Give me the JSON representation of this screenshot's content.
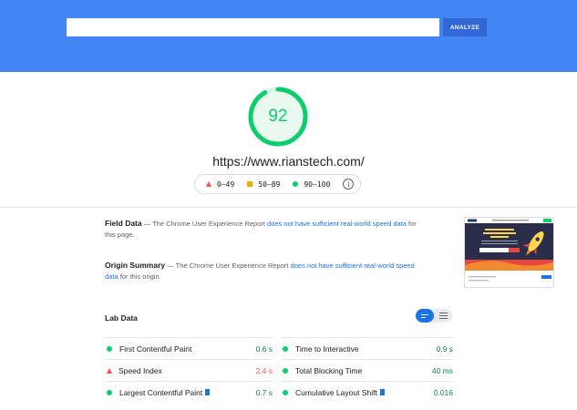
{
  "header": {
    "url_input_value": "",
    "analyze_label": "ANALYZE"
  },
  "score": {
    "value": "92",
    "fraction": 0.92,
    "color": "#0cce6b"
  },
  "site_url": "https://www.rianstech.com/",
  "legend": {
    "fail": "0–49",
    "average": "50–89",
    "pass": "90–100"
  },
  "field_data": {
    "heading": "Field Data",
    "text_before": " — The Chrome User Experience Report ",
    "link": "does not have sufficient real-world speed data",
    "text_after": " for this page."
  },
  "origin_summary": {
    "heading": "Origin Summary",
    "text_before": " — The Chrome User Experience Report ",
    "link": "does not have sufficient real-world speed data",
    "text_after": " for this origin."
  },
  "lab": {
    "title": "Lab Data"
  },
  "metrics": [
    {
      "name": "First Contentful Paint",
      "value": "0.6 s",
      "status": "pass",
      "flag": false
    },
    {
      "name": "Time to Interactive",
      "value": "0.9 s",
      "status": "pass",
      "flag": false
    },
    {
      "name": "Speed Index",
      "value": "2.4 s",
      "status": "fail",
      "flag": false
    },
    {
      "name": "Total Blocking Time",
      "value": "40 ms",
      "status": "pass",
      "flag": false
    },
    {
      "name": "Largest Contentful Paint",
      "value": "0.7 s",
      "status": "pass",
      "flag": true
    },
    {
      "name": "Cumulative Layout Shift",
      "value": "0.016",
      "status": "pass",
      "flag": true
    }
  ],
  "colors": {
    "header_bg": "#4285f4",
    "pass": "#0cce6b",
    "average": "#ffa400",
    "fail": "#ff4e42",
    "link": "#1a73e8"
  }
}
